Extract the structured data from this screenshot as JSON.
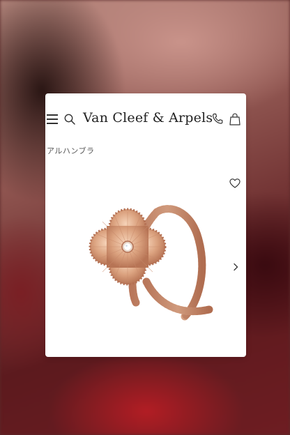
{
  "header": {
    "logo_text": "Van Cleef & Arpels",
    "menu_icon": "hamburger-menu-icon",
    "search_icon": "search-icon",
    "phone_icon": "phone-icon",
    "bag_icon": "shopping-bag-icon"
  },
  "breadcrumb": {
    "label": "アルハンブラ"
  },
  "product": {
    "image": "rose-gold-alhambra-ring",
    "wishlist_icon": "heart-icon",
    "next_icon": "chevron-right-icon"
  },
  "colors": {
    "card_background": "#ffffff",
    "text": "#222222",
    "rose_gold": "#d9a07e"
  }
}
